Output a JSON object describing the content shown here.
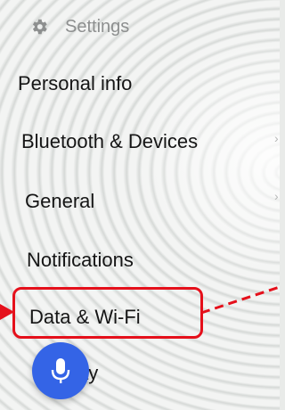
{
  "header": {
    "title": "Settings",
    "icon": "gear-icon"
  },
  "menu": {
    "items": [
      {
        "label": "Personal info"
      },
      {
        "label": "Bluetooth & Devices"
      },
      {
        "label": "General"
      },
      {
        "label": "Notifications"
      },
      {
        "label": "Data & Wi-Fi"
      },
      {
        "label": "ay"
      }
    ]
  },
  "colors": {
    "highlight": "#e5101b",
    "mic_button": "#3464e6",
    "header_text": "#8d8f8f"
  },
  "mic_button": {
    "icon": "microphone-icon"
  }
}
